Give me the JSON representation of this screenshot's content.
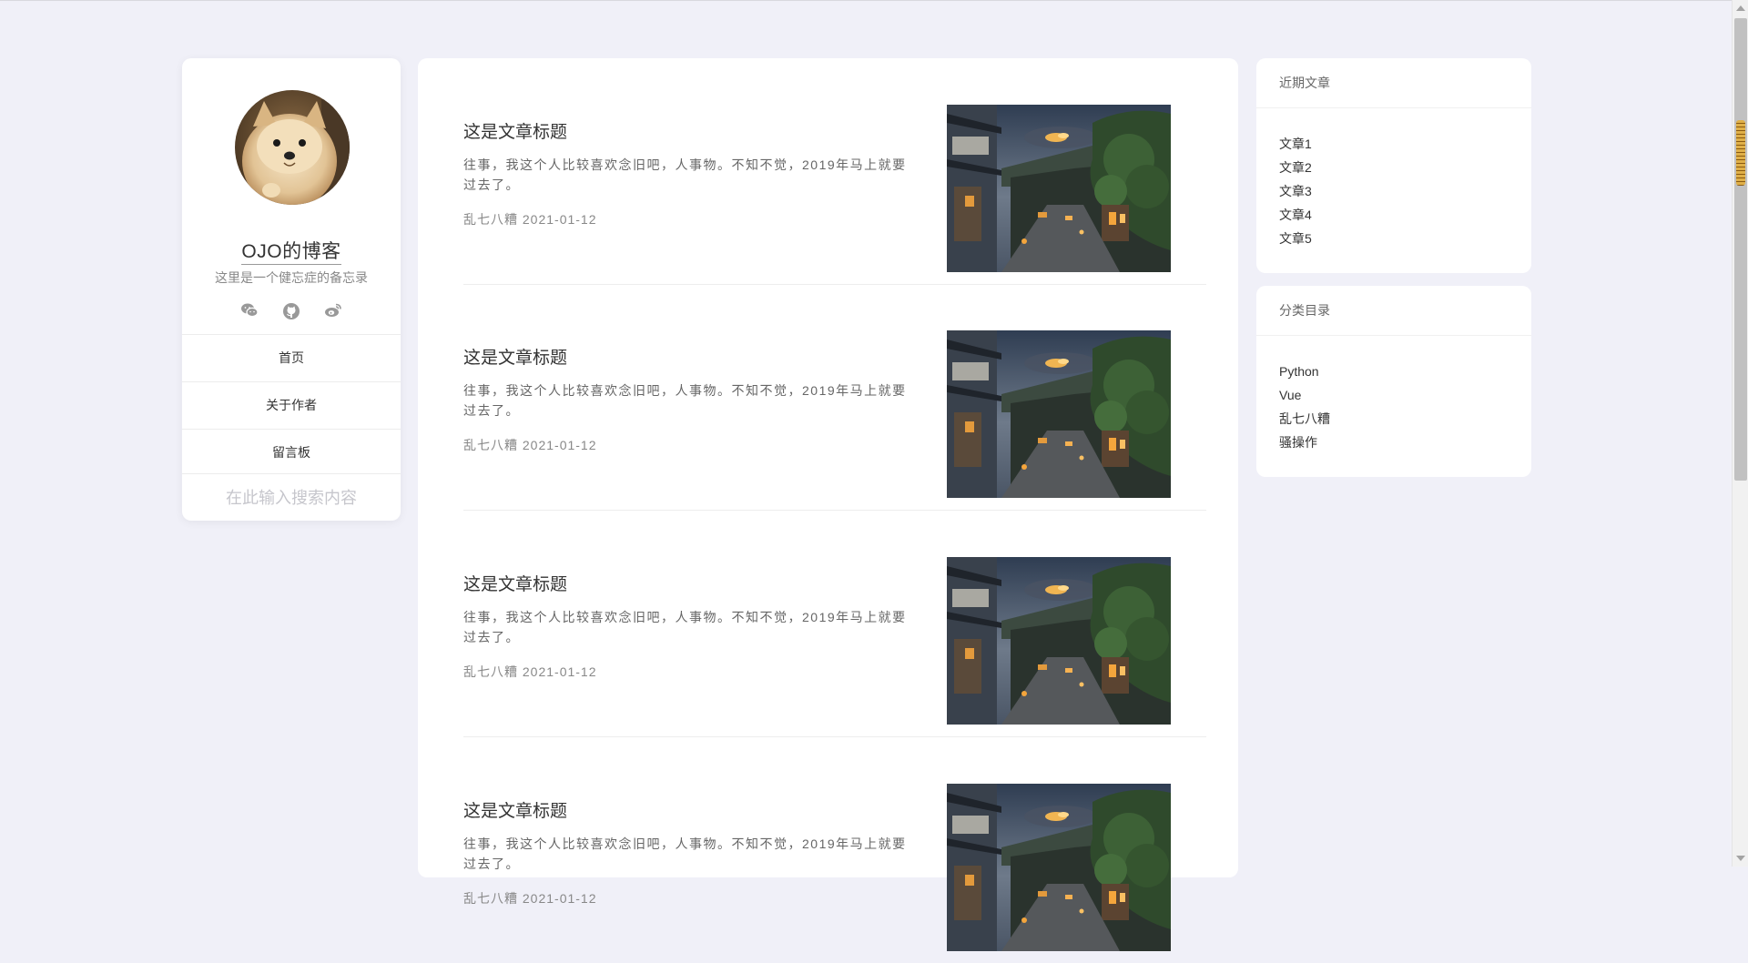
{
  "profile": {
    "site_title": "OJO的博客",
    "site_subtitle": "这里是一个健忘症的备忘录",
    "socials": [
      "wechat-icon",
      "github-icon",
      "weibo-icon"
    ],
    "nav": [
      {
        "label": "首页"
      },
      {
        "label": "关于作者"
      },
      {
        "label": "留言板"
      }
    ],
    "search_placeholder": "在此输入搜索内容"
  },
  "articles": [
    {
      "title": "这是文章标题",
      "excerpt": "往事，我这个人比较喜欢念旧吧，人事物。不知不觉，2019年马上就要过去了。",
      "category": "乱七八糟",
      "date": "2021-01-12"
    },
    {
      "title": "这是文章标题",
      "excerpt": "往事，我这个人比较喜欢念旧吧，人事物。不知不觉，2019年马上就要过去了。",
      "category": "乱七八糟",
      "date": "2021-01-12"
    },
    {
      "title": "这是文章标题",
      "excerpt": "往事，我这个人比较喜欢念旧吧，人事物。不知不觉，2019年马上就要过去了。",
      "category": "乱七八糟",
      "date": "2021-01-12"
    },
    {
      "title": "这是文章标题",
      "excerpt": "往事，我这个人比较喜欢念旧吧，人事物。不知不觉，2019年马上就要过去了。",
      "category": "乱七八糟",
      "date": "2021-01-12"
    }
  ],
  "recent_posts": {
    "title": "近期文章",
    "items": [
      "文章1",
      "文章2",
      "文章3",
      "文章4",
      "文章5"
    ]
  },
  "categories": {
    "title": "分类目录",
    "items": [
      "Python",
      "Vue",
      "乱七八糟",
      "骚操作"
    ]
  },
  "colors": {
    "background": "#f0f0f8",
    "card": "#ffffff",
    "muted_text": "#888888",
    "placeholder": "#c6c6cc"
  }
}
